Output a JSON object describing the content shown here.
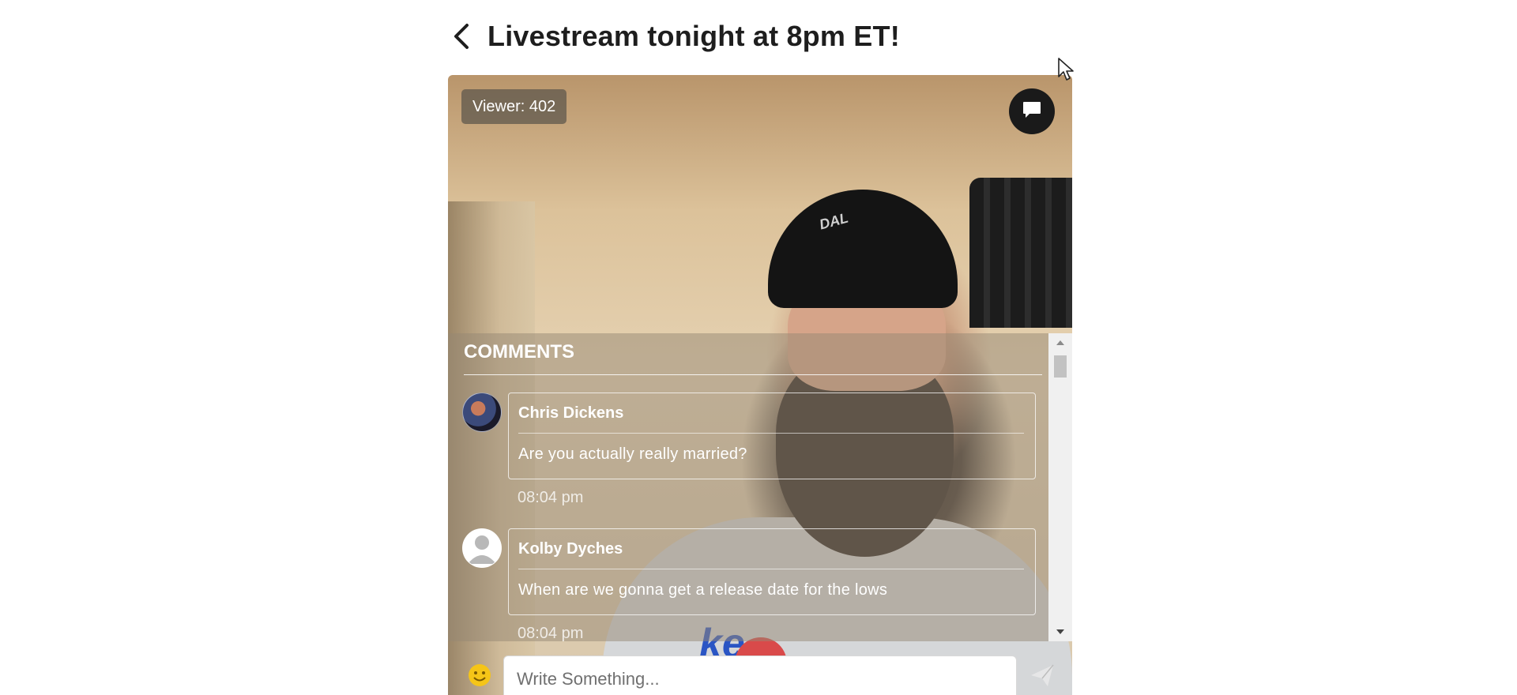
{
  "header": {
    "title": "Livestream tonight at 8pm ET!",
    "back_icon": "chevron-left-icon"
  },
  "stream": {
    "viewer_label": "Viewer: 402",
    "viewer_count": 402,
    "chat_toggle_icon": "chat-bubble-icon",
    "shirt_text": "ke"
  },
  "comments": {
    "heading": "COMMENTS",
    "items": [
      {
        "author": "Chris Dickens",
        "message": "Are you actually really married?",
        "time": "08:04 pm",
        "avatar": "photo"
      },
      {
        "author": "Kolby Dyches",
        "message": "When are we gonna get a release date for the lows",
        "time": "08:04 pm",
        "avatar": "default-user"
      }
    ]
  },
  "composer": {
    "placeholder": "Write Something...",
    "emoji_icon": "smiley-icon",
    "send_icon": "send-icon"
  },
  "colors": {
    "accent_red": "#d94a4a",
    "dark": "#1a1a1a",
    "text_white": "#ffffff"
  }
}
